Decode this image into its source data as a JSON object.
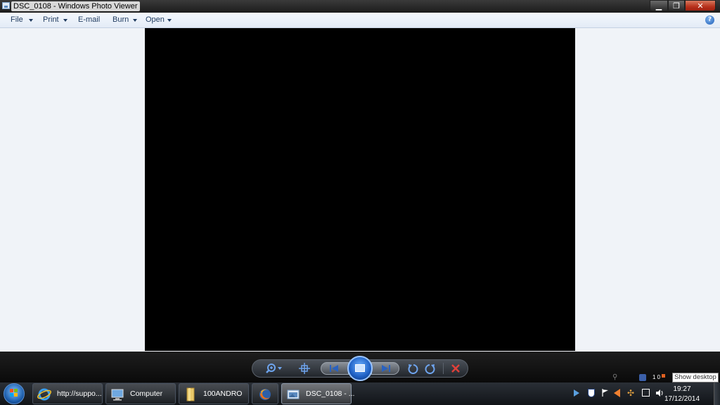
{
  "window": {
    "title": "DSC_0108 - Windows Photo Viewer",
    "min_symbol": "▁",
    "max_symbol": "❐",
    "close_symbol": "✕"
  },
  "menu": {
    "items": [
      {
        "label": "File",
        "has_arrow": true
      },
      {
        "label": "Print",
        "has_arrow": true
      },
      {
        "label": "E-mail",
        "has_arrow": false
      },
      {
        "label": "Burn",
        "has_arrow": true
      },
      {
        "label": "Open",
        "has_arrow": true
      }
    ],
    "help_symbol": "?"
  },
  "controls": {
    "zoom_icon": "zoom-icon",
    "actual_size_icon": "actual-size-icon",
    "previous_icon": "previous-icon",
    "slideshow_icon": "slideshow-icon",
    "next_icon": "next-icon",
    "rotate_ccw_icon": "rotate-counterclockwise-icon",
    "rotate_cw_icon": "rotate-clockwise-icon",
    "delete_icon": "delete-icon"
  },
  "taskbar": {
    "items": [
      {
        "label": "http://suppo...",
        "icon": "internet-explorer-icon"
      },
      {
        "label": "Computer",
        "icon": "computer-icon"
      },
      {
        "label": "100ANDRO",
        "icon": "folder-icon"
      },
      {
        "label": "",
        "icon": "firefox-icon"
      },
      {
        "label": "DSC_0108 - ...",
        "icon": "photo-viewer-icon",
        "active": true
      }
    ],
    "tray_badge": "1 0",
    "time": "19:27",
    "date": "17/12/2014",
    "show_desktop_tooltip": "Show desktop"
  },
  "colors": {
    "photo_background": "#000000",
    "viewer_background": "#f0f3f8",
    "accent_blue": "#1f5fb8",
    "close_red": "#b8321c",
    "delete_red": "#e0403a"
  }
}
